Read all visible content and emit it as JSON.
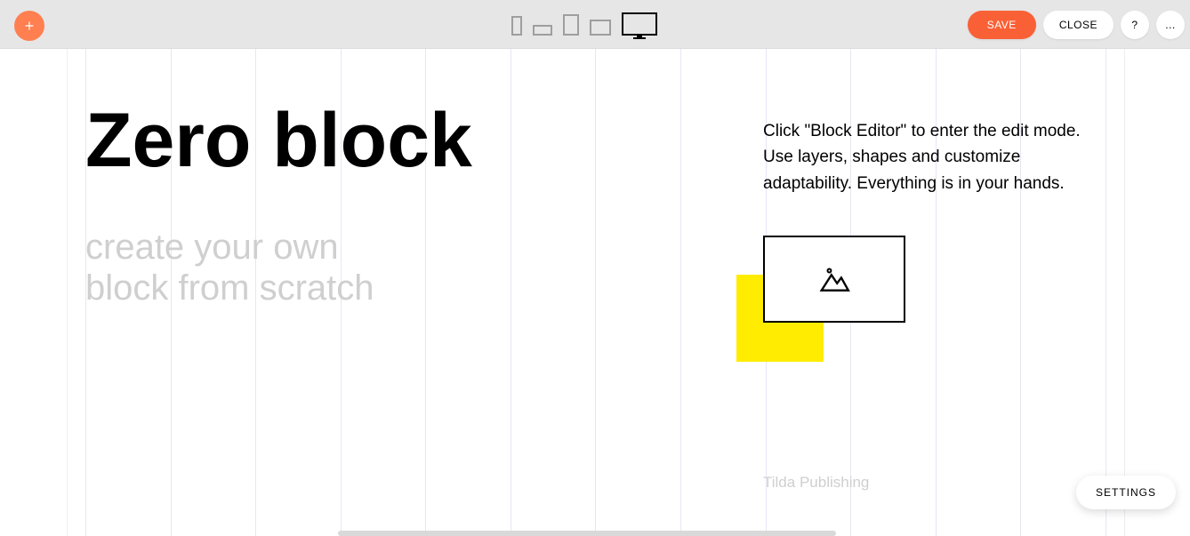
{
  "toolbar": {
    "save_label": "SAVE",
    "close_label": "CLOSE",
    "help_label": "?",
    "more_label": "..."
  },
  "devices": {
    "active": "desktop"
  },
  "canvas": {
    "headline": "Zero block",
    "subheadline": "create your own\nblock from scratch",
    "body": "Click \"Block Editor\" to enter the edit mode. Use layers, shapes and customize adaptability. Everything is in your hands.",
    "credit": "Tilda Publishing",
    "shapes": {
      "yellow_square_color": "#ffec00"
    }
  },
  "floating": {
    "settings_label": "SETTINGS"
  }
}
